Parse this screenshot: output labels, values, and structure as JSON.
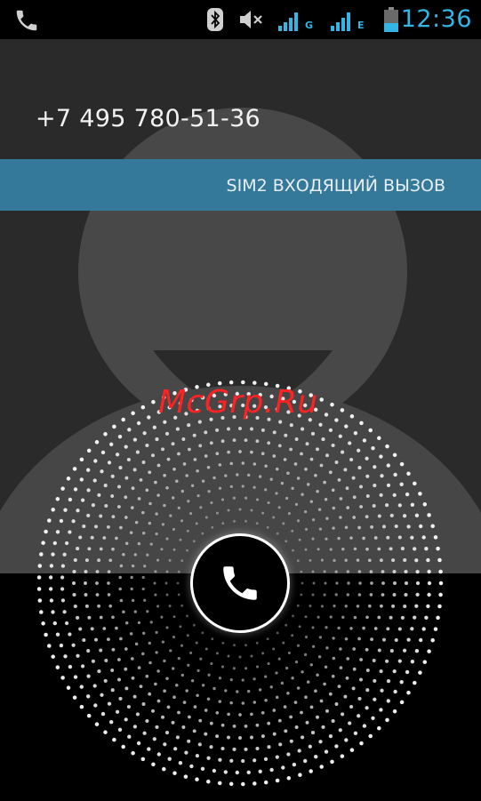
{
  "status_bar": {
    "time": "12:36",
    "sim1_network": "G",
    "sim2_network": "E",
    "icons": [
      "call-in-progress-icon",
      "bluetooth-icon",
      "mute-icon",
      "signal-icon",
      "battery-icon"
    ]
  },
  "call": {
    "number": "+7 495 780-51-36",
    "sim_status": "SIM2 ВХОДЯЩИЙ ВЫЗОВ"
  },
  "watermark": {
    "text": "McGrp.Ru"
  },
  "colors": {
    "accent": "#33b5e5",
    "banner": "#34799a",
    "avatar": "#4a4a4a",
    "background": "#2a2a2a"
  }
}
